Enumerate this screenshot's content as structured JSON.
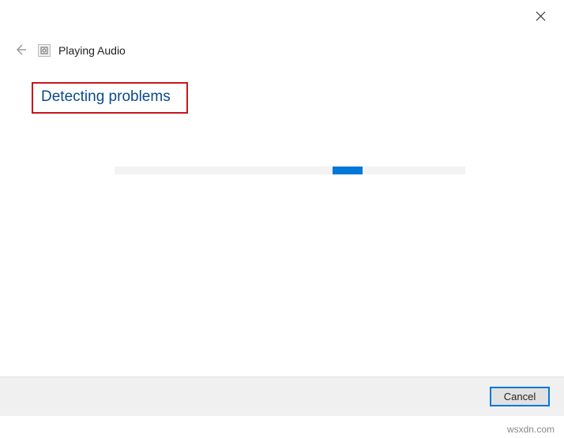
{
  "window": {
    "title": "Playing Audio"
  },
  "status": {
    "heading": "Detecting problems"
  },
  "buttons": {
    "cancel": "Cancel"
  },
  "watermark": "wsxdn.com",
  "colors": {
    "accent": "#0078d7",
    "highlight_border": "#c4171c",
    "heading_text": "#0a4b8c"
  }
}
